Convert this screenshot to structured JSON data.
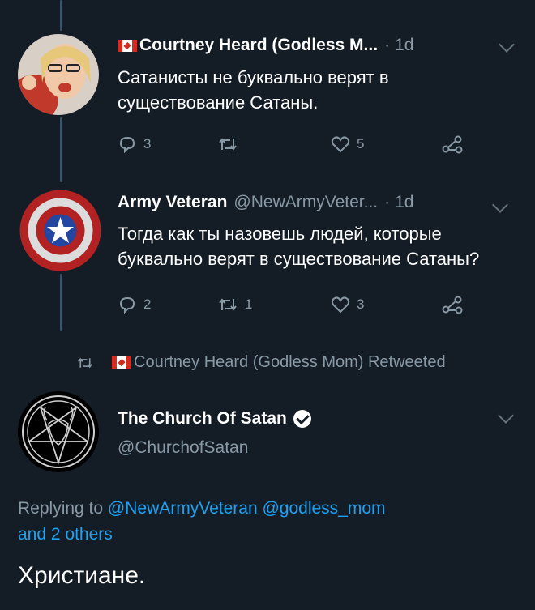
{
  "colors": {
    "background": "#141d26",
    "muted": "#8899a6",
    "link": "#1da1f2",
    "thread_line": "#3d5466"
  },
  "tweet1": {
    "name": "Courtney Heard (Godless M...",
    "time": "1d",
    "text_line1": "Сатанисты не буквально верят в",
    "text_line2": "существование Сатаны.",
    "replies": "3",
    "retweets": "",
    "likes": "5"
  },
  "tweet2": {
    "name": "Army Veteran",
    "handle": "@NewArmyVeter...",
    "time": "1d",
    "text_line1": "Тогда как ты назовешь людей, которые",
    "text_line2": "буквально верят в существование Сатаны?",
    "replies": "2",
    "retweets": "1",
    "likes": "3"
  },
  "retweet_notice": "Courtney Heard (Godless Mom) Retweeted",
  "main_tweet": {
    "name": "The Church Of Satan",
    "handle": "@ChurchofSatan",
    "replying_prefix": "Replying to",
    "mention1": "@NewArmyVeteran",
    "mention2": "@godless_mom",
    "others": "and 2 others",
    "text": "Христиане."
  },
  "icons": [
    "reply-icon",
    "retweet-icon",
    "like-icon",
    "share-icon",
    "chevron-down-icon",
    "verified-icon",
    "canada-flag-icon"
  ]
}
